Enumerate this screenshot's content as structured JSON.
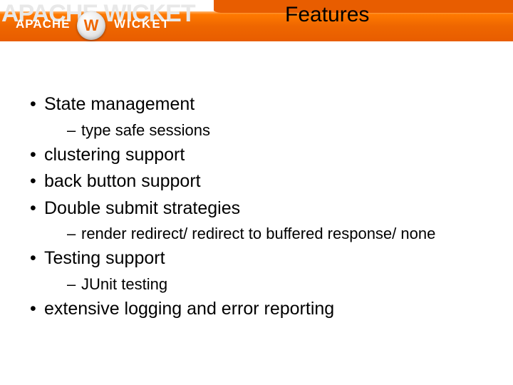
{
  "header": {
    "title": "Features",
    "ghost_text": "APACHE WICKET",
    "brand_left": "APACHE",
    "brand_right": "WICKET",
    "emblem_glyph": "W"
  },
  "content": {
    "items": [
      {
        "text": "State management",
        "sub": [
          "type safe sessions"
        ]
      },
      {
        "text": "clustering support",
        "sub": []
      },
      {
        "text": "back button support",
        "sub": []
      },
      {
        "text": "Double submit strategies",
        "sub": [
          "render redirect/ redirect to buffered response/ none"
        ]
      },
      {
        "text": "Testing support",
        "sub": [
          "JUnit testing"
        ]
      },
      {
        "text": "extensive logging and error reporting",
        "sub": []
      }
    ]
  },
  "colors": {
    "accent": "#ee6600"
  }
}
